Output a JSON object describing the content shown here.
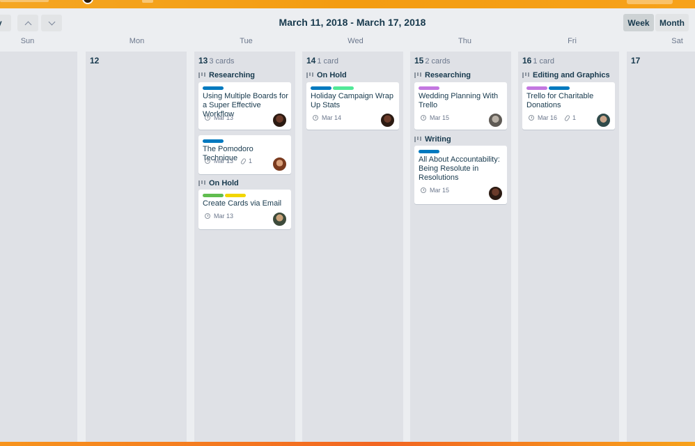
{
  "header": {
    "range_title": "March 11, 2018 - March 17, 2018",
    "today_label": "y",
    "week_label": "Week",
    "month_label": "Month"
  },
  "days_of_week": [
    "Sun",
    "Mon",
    "Tue",
    "Wed",
    "Thu",
    "Fri",
    "Sat"
  ],
  "days": [
    {
      "num": "12",
      "count": ""
    },
    {
      "num": "13",
      "count": "3 cards"
    },
    {
      "num": "14",
      "count": "1 card"
    },
    {
      "num": "15",
      "count": "2 cards"
    },
    {
      "num": "16",
      "count": "1 card"
    },
    {
      "num": "17",
      "count": ""
    }
  ],
  "lists": {
    "tue_researching": "Researching",
    "tue_on_hold": "On Hold",
    "wed_on_hold": "On Hold",
    "thu_researching": "Researching",
    "thu_writing": "Writing",
    "fri_editing": "Editing and Graphics"
  },
  "cards": [
    {
      "title": "Using Multiple Boards for a Super Effective Workflow",
      "due": "Mar 13",
      "attachments": "",
      "labels": [
        "#0079bf"
      ]
    },
    {
      "title": "The Pomodoro Technique",
      "due": "Mar 13",
      "attachments": "1",
      "labels": [
        "#0079bf"
      ]
    },
    {
      "title": "Create Cards via Email",
      "due": "Mar 13",
      "attachments": "",
      "labels": [
        "#61bd4f",
        "#f2d600"
      ]
    },
    {
      "title": "Holiday Campaign Wrap Up Stats",
      "due": "Mar 14",
      "attachments": "",
      "labels": [
        "#0079bf",
        "#51e898"
      ]
    },
    {
      "title": "Wedding Planning With Trello",
      "due": "Mar 15",
      "attachments": "",
      "labels": [
        "#c377e0"
      ]
    },
    {
      "title": "All About Accountability: Being Resolute in Resolutions",
      "due": "Mar 15",
      "attachments": "",
      "labels": [
        "#0079bf"
      ]
    },
    {
      "title": "Trello for Charitable Donations",
      "due": "Mar 16",
      "attachments": "1",
      "labels": [
        "#c377e0",
        "#0079bf"
      ]
    }
  ],
  "colors": {
    "accent_orange": "#f5a623",
    "label_blue": "#0079bf",
    "label_green": "#61bd4f",
    "label_yellow": "#f2d600",
    "label_lime": "#51e898",
    "label_purple": "#c377e0"
  }
}
